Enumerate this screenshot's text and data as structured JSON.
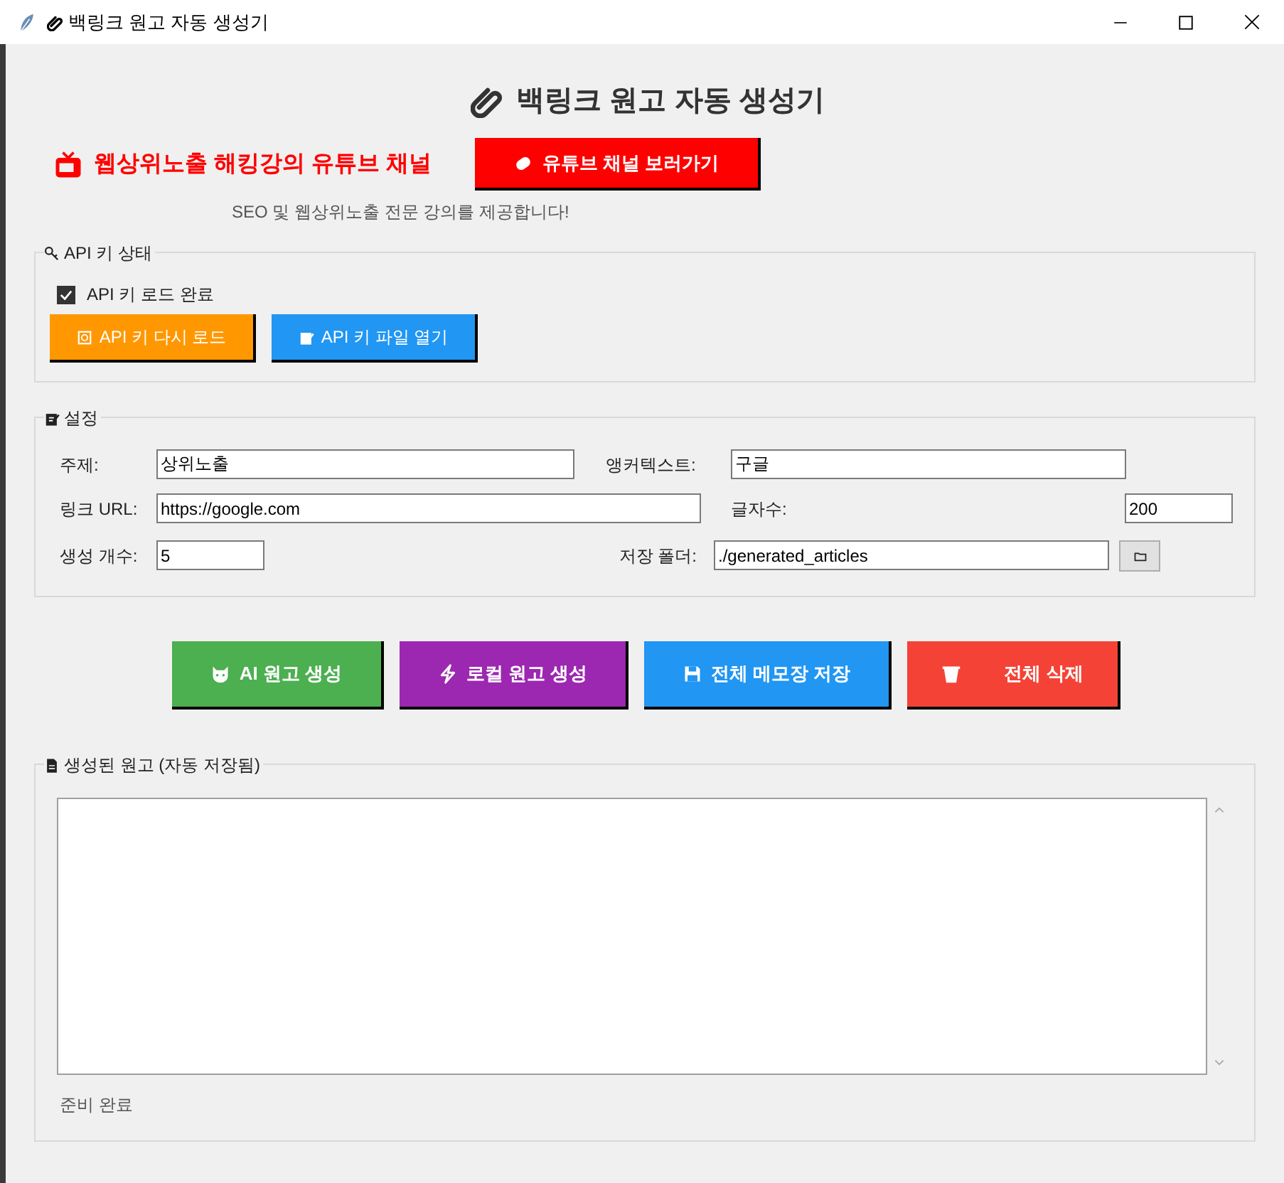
{
  "window": {
    "title": "백링크 원고 자동 생성기"
  },
  "header": {
    "title": "백링크 원고 자동 생성기"
  },
  "youtube": {
    "label": "웹상위노출 해킹강의 유튜브 채널",
    "button": "유튜브 채널 보러가기",
    "subtitle": "SEO 및 웹상위노출 전문 강의를 제공합니다!"
  },
  "api_group": {
    "legend": "API 키 상태",
    "checkbox": {
      "label": "API 키 로드 완료",
      "checked": true
    },
    "buttons": [
      {
        "label": "API 키 다시 로드",
        "color": "#ff9800"
      },
      {
        "label": "API 키 파일 열기",
        "color": "#2196f3"
      }
    ]
  },
  "settings": {
    "legend": "설정",
    "fields": [
      {
        "label": "주제:",
        "value": "상위노출"
      },
      {
        "label": "앵커텍스트:",
        "value": "구글"
      },
      {
        "label": "링크 URL:",
        "value": "https://google.com"
      },
      {
        "label": "글자수:",
        "value": "200"
      },
      {
        "label": "생성 개수:",
        "value": "5"
      },
      {
        "label": "저장 폴더:",
        "value": "./generated_articles"
      }
    ]
  },
  "action_buttons": [
    {
      "label": "AI 원고 생성",
      "color": "#4caf50"
    },
    {
      "label": "로컬 원고 생성",
      "color": "#9c27b0"
    },
    {
      "label": "전체 메모장 저장",
      "color": "#2196f3"
    },
    {
      "label": "전체 삭제",
      "color": "#f44336"
    }
  ],
  "output": {
    "legend": "생성된 원고 (자동 저장됨)",
    "status": "준비 완료"
  }
}
